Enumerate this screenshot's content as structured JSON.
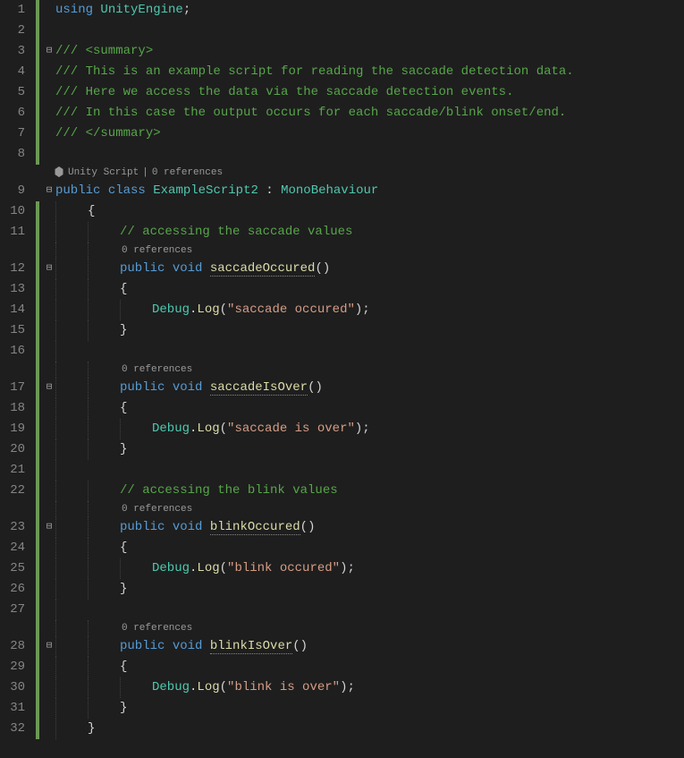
{
  "line_numbers": [
    "1",
    "2",
    "3",
    "4",
    "5",
    "6",
    "7",
    "8",
    "",
    "9",
    "10",
    "11",
    "",
    "12",
    "13",
    "14",
    "15",
    "16",
    "",
    "17",
    "18",
    "19",
    "20",
    "21",
    "22",
    "",
    "23",
    "24",
    "25",
    "26",
    "27",
    "",
    "28",
    "29",
    "30",
    "31",
    "32"
  ],
  "code": {
    "using": "using",
    "unityEngine": "UnityEngine",
    "semicolon": ";",
    "xml_open": "/// <summary>",
    "xml_l1": "/// This is an example script for reading the saccade detection data.",
    "xml_l2": "/// Here we access the data via the saccade detection events.",
    "xml_l3": "/// In this case the output occurs for each saccade/blink onset/end.",
    "xml_close": "/// </summary>",
    "public": "public",
    "class": "class",
    "className": "ExampleScript2",
    "colon": " : ",
    "baseClass": "MonoBehaviour",
    "lbrace": "{",
    "rbrace": "}",
    "comment_saccade": "// accessing the saccade values",
    "comment_blink": "// accessing the blink values",
    "void": "void",
    "debug": "Debug",
    "dot": ".",
    "log": "Log",
    "lparen": "(",
    "rparen": ")",
    "m_saccadeOccured": "saccadeOccured",
    "m_saccadeIsOver": "saccadeIsOver",
    "m_blinkOccured": "blinkOccured",
    "m_blinkIsOver": "blinkIsOver",
    "s_saccadeOccured": "\"saccade occured\"",
    "s_saccadeIsOver": "\"saccade is over\"",
    "s_blinkOccured": "\"blink occured\"",
    "s_blinkIsOver": "\"blink is over\""
  },
  "codelens": {
    "unityScript": "Unity Script",
    "refs0": "0 references"
  },
  "fold": {
    "minus": "⊟"
  }
}
